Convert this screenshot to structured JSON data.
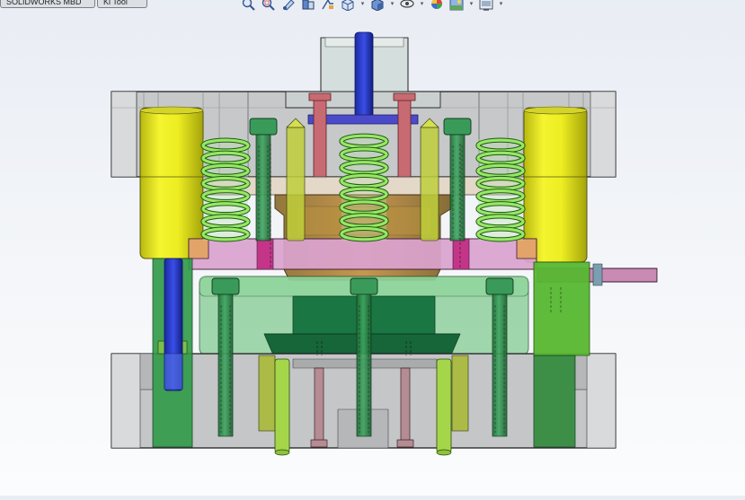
{
  "document_tabs": [
    {
      "label": "SOLIDWORKS MBD"
    },
    {
      "label": "Ki  Tool"
    }
  ],
  "heads_up_toolbar": [
    {
      "icon": "zoom-to-fit-icon"
    },
    {
      "icon": "zoom-to-area-icon"
    },
    {
      "icon": "previous-view-icon"
    },
    {
      "icon": "section-view-icon"
    },
    {
      "icon": "dynamic-annotation-icon"
    },
    {
      "icon": "view-orientation-icon",
      "dropdown": true
    },
    {
      "icon": "display-style-icon",
      "dropdown": true
    },
    {
      "icon": "hide-show-items-icon",
      "dropdown": true
    },
    {
      "icon": "edit-appearance-icon",
      "dropdown": false
    },
    {
      "icon": "apply-scene-icon",
      "dropdown": true
    },
    {
      "icon": "view-settings-icon",
      "dropdown": true
    }
  ],
  "colors": {
    "background_top": "#e9edf4",
    "plate_gray": "#c9cbcd",
    "spring_green": "#8ee05a",
    "guide_yellow": "#e8e820",
    "bolt_green": "#2e8b4a",
    "stripper_pink": "#d889c0",
    "ejector_blue": "#2233cc",
    "edge": "#1a1a1a"
  }
}
